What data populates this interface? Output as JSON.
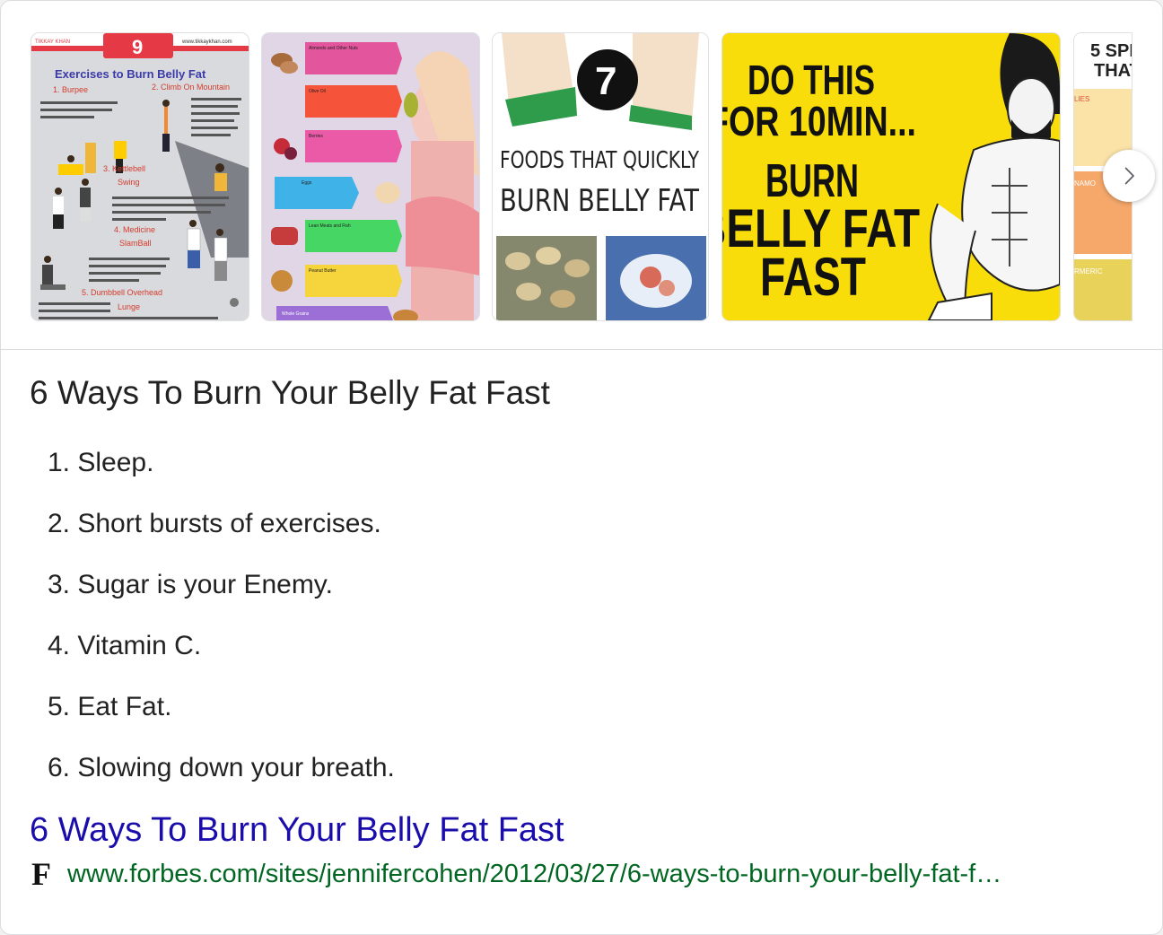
{
  "carousel": {
    "images": [
      {
        "brand": "TIKKAY KHAN",
        "number": "9",
        "site": "www.tikkaykhan.com",
        "heading": "Exercises to Burn Belly Fat",
        "labels": [
          "1. Burpee",
          "2. Climb On Mountain",
          "3. Kettlebell",
          "Swing",
          "4. Medicine",
          "SlamBall",
          "5. Dumbbell Overhead",
          "Lunge"
        ]
      },
      {
        "labels": [
          "Almonds and Other Nuts",
          "Olive Oil",
          "Berries",
          "Eggs",
          "Lean Meats and Fish",
          "Peanut Butter",
          "Whole Grains"
        ]
      },
      {
        "number": "7",
        "line1": "FOODS THAT QUICKLY",
        "line2": "BURN BELLY FAT"
      },
      {
        "line1": "DO THIS",
        "line2": "FOR 10MIN...",
        "line3": "BURN",
        "line4": "BELLY FAT",
        "line5": "FAST"
      },
      {
        "line1": "5 SPI",
        "line2": "THAT",
        "labels": [
          "LIES",
          "NAMO",
          "RMERIC"
        ]
      }
    ],
    "next_icon": "chevron-right-icon"
  },
  "snippet": {
    "title": "6 Ways To Burn Your Belly Fat Fast",
    "items": [
      "1. Sleep.",
      "2. Short bursts of exercises.",
      "3. Sugar is your Enemy.",
      "4. Vitamin C.",
      "5. Eat Fat.",
      "6. Slowing down your breath."
    ]
  },
  "result": {
    "link_text": "6 Ways To Burn Your Belly Fat Fast",
    "favicon": "F",
    "url": "www.forbes.com/sites/jennifercohen/2012/03/27/6-ways-to-burn-your-belly-fat-f…"
  },
  "colors": {
    "link": "#1a0dab",
    "url": "#006621",
    "text": "#222222",
    "thumb_yellow": "#f8dd0a"
  }
}
